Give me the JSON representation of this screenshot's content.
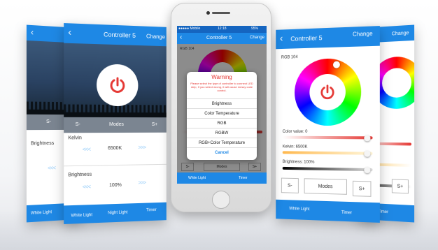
{
  "colors": {
    "accent": "#1e88e5",
    "power": "#e53935",
    "warning_text": "#e53935",
    "cancel": "#1e88e5"
  },
  "card1": {
    "back_icon": "back-chevron-icon",
    "minus": "S-",
    "label": "Brightness",
    "arrows": "<<<",
    "footer_left": "White Light"
  },
  "card2": {
    "back_icon": "back-chevron-icon",
    "title": "Controller 5",
    "change": "Change",
    "minus": "S-",
    "modes": "Modes",
    "plus": "S+",
    "kelvin_label": "Kelvin",
    "kelvin_left_arrows": "<<<",
    "kelvin_value": "6500K",
    "kelvin_right_arrows": ">>>",
    "brightness_label": "Brightness",
    "brightness_left_arrows": "<<<",
    "brightness_value": "100%",
    "brightness_right_arrows": ">>>",
    "tabs": [
      "White Light",
      "Night Light",
      "Timer"
    ]
  },
  "phone": {
    "status_carrier": "●●●●● Mobile",
    "status_time": "12:18",
    "status_battery": "95%",
    "title": "Controller 5",
    "change": "Change",
    "rgb_label": "RGB 104",
    "dialog_title": "Warning",
    "dialog_message": "Please select the type of controller to connect LED strip, If you select wrong, it will cause messy code control.",
    "options": [
      "Brightness",
      "Color Temperature",
      "RGB",
      "RGBW",
      "RGB+Color Temperature"
    ],
    "cancel": "Cancel",
    "minus": "S-",
    "modes": "Modes",
    "plus": "S+",
    "tabs": [
      "White Light",
      "Timer"
    ]
  },
  "card4": {
    "back_icon": "back-chevron-icon",
    "title": "Controller 5",
    "change": "Change",
    "rgb_label": "RGB 104",
    "color_label": "Color value: 0",
    "kelvin_label": "Kelvin: 6500K",
    "brightness_label": "Brightness: 100%",
    "minus": "S-",
    "modes": "Modes",
    "plus": "S+",
    "tabs": [
      "White Light",
      "Timer"
    ]
  },
  "card5": {
    "change": "Change",
    "plus": "S+",
    "footer": "Timer"
  }
}
